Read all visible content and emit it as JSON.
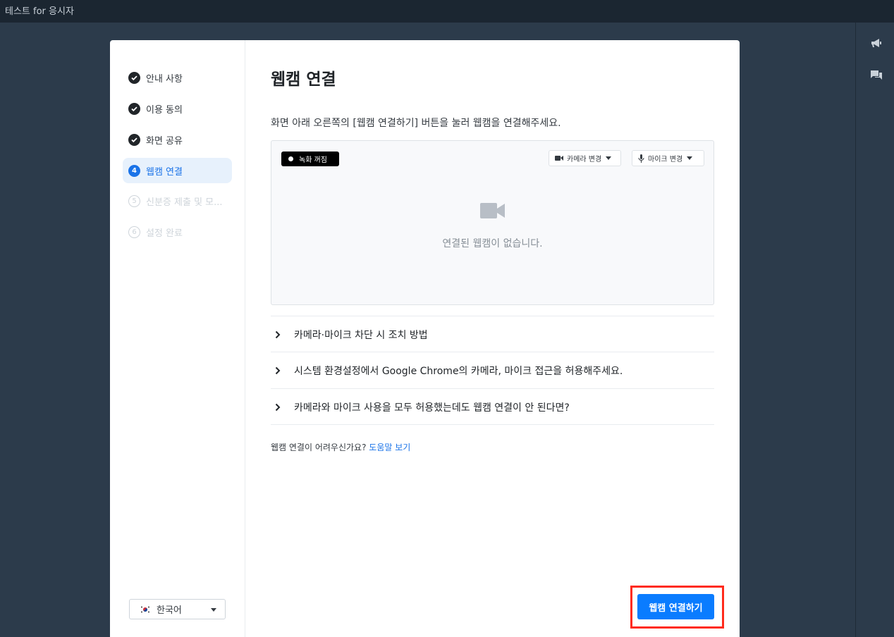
{
  "window": {
    "title": "테스트 for 응시자"
  },
  "right_rail": {
    "icons": [
      "megaphone-icon",
      "chat-icon"
    ]
  },
  "sidebar": {
    "steps": [
      {
        "number": "1",
        "label": "안내 사항",
        "state": "done"
      },
      {
        "number": "2",
        "label": "이용 동의",
        "state": "done"
      },
      {
        "number": "3",
        "label": "화면 공유",
        "state": "done"
      },
      {
        "number": "4",
        "label": "웹캠 연결",
        "state": "active"
      },
      {
        "number": "5",
        "label": "신분증 제출 및 모...",
        "state": "todo"
      },
      {
        "number": "6",
        "label": "설정 완료",
        "state": "todo"
      }
    ],
    "language": {
      "flag": "korea-flag",
      "label": "한국어"
    }
  },
  "main": {
    "title": "웹캠 연결",
    "description": "화면 아래 오른쪽의 [웹캠 연결하기] 버튼을 눌러 웹캠을 연결해주세요.",
    "preview": {
      "recording_badge": "녹화 꺼짐",
      "camera_dropdown": "카메라 변경",
      "mic_dropdown": "마이크 변경",
      "empty_text": "연결된 웹캠이 없습니다."
    },
    "accordion": [
      "카메라·마이크 차단 시 조치 방법",
      "시스템 환경설정에서 Google Chrome의 카메라, 마이크 접근을 허용해주세요.",
      "카메라와 마이크 사용을 모두 허용했는데도 웹캠 연결이 안 된다면?"
    ],
    "help": {
      "text": "웹캠 연결이 어려우신가요?",
      "link": "도움말 보기"
    },
    "connect_button": "웹캠 연결하기"
  },
  "colors": {
    "accent": "#0a7cff",
    "highlight_frame": "#ff2b1c",
    "background": "#2c3b4b"
  }
}
